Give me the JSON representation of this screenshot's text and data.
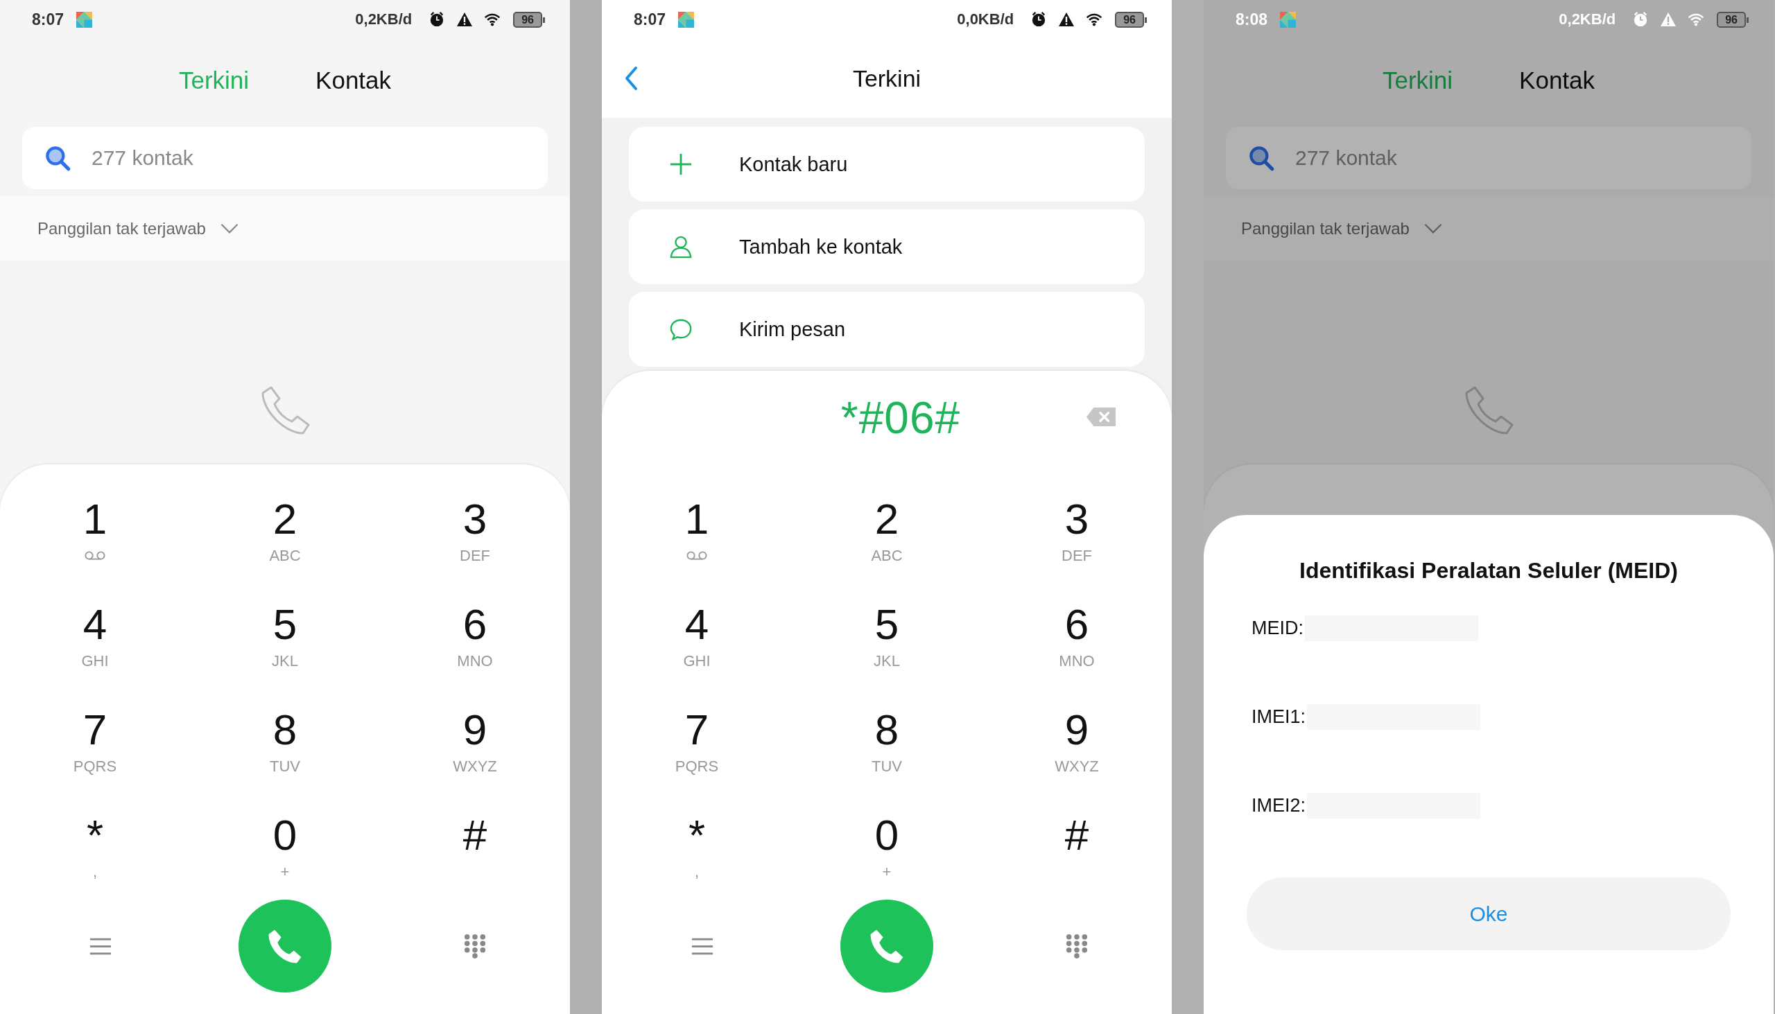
{
  "panels": [
    {
      "kind": "dialer_home",
      "dimmed": false,
      "status_bar": {
        "time": "8:07",
        "data_rate": "0,2KB/d",
        "battery": "96"
      },
      "tabs": [
        {
          "label": "Terkini",
          "selected": true
        },
        {
          "label": "Kontak",
          "selected": false
        }
      ],
      "search": {
        "placeholder": "277 kontak"
      },
      "filter": {
        "label": "Panggilan tak terjawab"
      },
      "keypad": {
        "keys": [
          {
            "digit": "1",
            "kind": "voicemail"
          },
          {
            "digit": "2",
            "kind": "letters",
            "sub": "ABC"
          },
          {
            "digit": "3",
            "kind": "letters",
            "sub": "DEF"
          },
          {
            "digit": "4",
            "kind": "letters",
            "sub": "GHI"
          },
          {
            "digit": "5",
            "kind": "letters",
            "sub": "JKL"
          },
          {
            "digit": "6",
            "kind": "letters",
            "sub": "MNO"
          },
          {
            "digit": "7",
            "kind": "letters",
            "sub": "PQRS"
          },
          {
            "digit": "8",
            "kind": "letters",
            "sub": "TUV"
          },
          {
            "digit": "9",
            "kind": "letters",
            "sub": "WXYZ"
          },
          {
            "digit": "*",
            "kind": "letters",
            "sub": ","
          },
          {
            "digit": "0",
            "kind": "letters",
            "sub": "+"
          },
          {
            "digit": "#",
            "kind": "letters"
          }
        ]
      }
    },
    {
      "kind": "dialer_input",
      "dimmed": false,
      "status_bar": {
        "time": "8:07",
        "data_rate": "0,0KB/d",
        "battery": "96"
      },
      "header": {
        "title": "Terkini"
      },
      "actions": [
        {
          "kind": "add",
          "label": "Kontak baru"
        },
        {
          "kind": "person",
          "label": "Tambah ke kontak"
        },
        {
          "kind": "message",
          "label": "Kirim pesan"
        }
      ],
      "input": {
        "value": "*#06#"
      },
      "keypad": {
        "keys": [
          {
            "digit": "1",
            "kind": "voicemail"
          },
          {
            "digit": "2",
            "kind": "letters",
            "sub": "ABC"
          },
          {
            "digit": "3",
            "kind": "letters",
            "sub": "DEF"
          },
          {
            "digit": "4",
            "kind": "letters",
            "sub": "GHI"
          },
          {
            "digit": "5",
            "kind": "letters",
            "sub": "JKL"
          },
          {
            "digit": "6",
            "kind": "letters",
            "sub": "MNO"
          },
          {
            "digit": "7",
            "kind": "letters",
            "sub": "PQRS"
          },
          {
            "digit": "8",
            "kind": "letters",
            "sub": "TUV"
          },
          {
            "digit": "9",
            "kind": "letters",
            "sub": "WXYZ"
          },
          {
            "digit": "*",
            "kind": "letters",
            "sub": ","
          },
          {
            "digit": "0",
            "kind": "letters",
            "sub": "+"
          },
          {
            "digit": "#",
            "kind": "letters"
          }
        ]
      }
    },
    {
      "kind": "dialer_home",
      "dimmed": true,
      "status_bar": {
        "time": "8:08",
        "data_rate": "0,2KB/d",
        "battery": "96"
      },
      "tabs": [
        {
          "label": "Terkini",
          "selected": true
        },
        {
          "label": "Kontak",
          "selected": false
        }
      ],
      "search": {
        "placeholder": "277 kontak"
      },
      "filter": {
        "label": "Panggilan tak terjawab"
      },
      "dialog": {
        "title": "Identifikasi Peralatan Seluler (MEID)",
        "fields": [
          {
            "label": "MEID:"
          },
          {
            "label": "IMEI1:"
          },
          {
            "label": "IMEI2:"
          }
        ],
        "button": "Oke"
      }
    }
  ]
}
